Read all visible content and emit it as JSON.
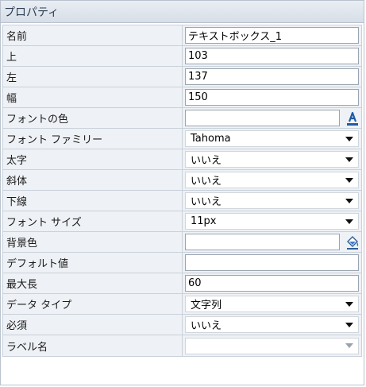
{
  "panel": {
    "title": "プロパティ"
  },
  "rows": {
    "name": {
      "label": "名前",
      "value": "テキストボックス_1"
    },
    "top": {
      "label": "上",
      "value": "103"
    },
    "left": {
      "label": "左",
      "value": "137"
    },
    "width": {
      "label": "幅",
      "value": "150"
    },
    "font_color": {
      "label": "フォントの色",
      "value": "",
      "icon": "font-color-icon",
      "accent": "#1f5ba8"
    },
    "font_family": {
      "label": "フォント ファミリー",
      "value": "Tahoma"
    },
    "bold": {
      "label": "太字",
      "value": "いいえ"
    },
    "italic": {
      "label": "斜体",
      "value": "いいえ"
    },
    "underline": {
      "label": "下線",
      "value": "いいえ"
    },
    "font_size": {
      "label": "フォント サイズ",
      "value": "11px"
    },
    "bg_color": {
      "label": "背景色",
      "value": "",
      "icon": "fill-bucket-icon"
    },
    "default": {
      "label": "デフォルト値",
      "value": ""
    },
    "maxlen": {
      "label": "最大長",
      "value": "60"
    },
    "data_type": {
      "label": "データ タイプ",
      "value": "文字列"
    },
    "required": {
      "label": "必須",
      "value": "いいえ"
    },
    "label_name": {
      "label": "ラベル名",
      "value": ""
    }
  }
}
